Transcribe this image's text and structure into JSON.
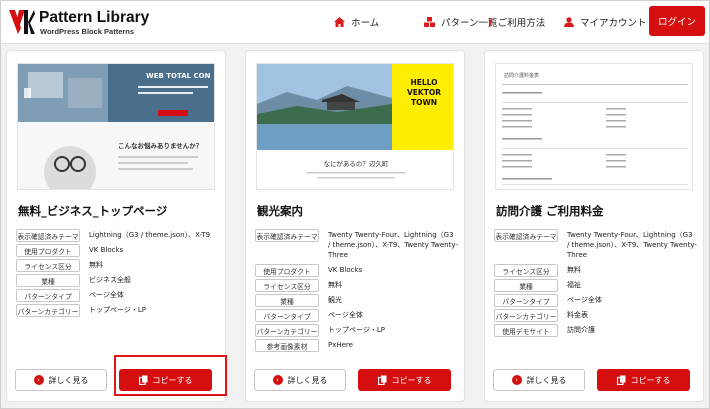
{
  "header": {
    "logo_title": "Pattern Library",
    "logo_subtitle": "WordPress Block Patterns",
    "nav": [
      {
        "label": "ホーム",
        "icon": "home-icon"
      },
      {
        "label": "パターン一覧",
        "icon": "cubes-icon"
      },
      {
        "label": "ご利用方法",
        "icon": "info-icon"
      },
      {
        "label": "マイアカウント",
        "icon": "user-icon"
      }
    ],
    "login_label": "ログイン"
  },
  "accent_color": "#d50f0f",
  "cards": [
    {
      "title": "無料_ビジネス_トップページ",
      "thumb": {
        "hero_text": "WEB TOTAL CON",
        "question": "こんなお悩みありませんか？"
      },
      "meta": [
        {
          "key": "表示確認済みテーマ",
          "value": "Lightning（G3 / theme.json）、X-T9"
        },
        {
          "key": "使用プロダクト",
          "value": "VK Blocks"
        },
        {
          "key": "ライセンス区分",
          "value": "無料"
        },
        {
          "key": "業種",
          "value": "ビジネス全般"
        },
        {
          "key": "パターンタイプ",
          "value": "ページ全体"
        },
        {
          "key": "パターンカテゴリー",
          "value": "トップページ・LP"
        }
      ],
      "detail_label": "詳しく見る",
      "copy_label": "コピーする"
    },
    {
      "title": "観光案内",
      "thumb": {
        "hello_text": "HELLO VEKTOR TOWN",
        "caption": "なにがあるの？辺久町"
      },
      "meta": [
        {
          "key": "表示確認済みテーマ",
          "value": "Twenty Twenty-Four、Lightning（G3 / theme.json）、X-T9、Twenty Twenty-Three"
        },
        {
          "key": "使用プロダクト",
          "value": "VK Blocks"
        },
        {
          "key": "ライセンス区分",
          "value": "無料"
        },
        {
          "key": "業種",
          "value": "観光"
        },
        {
          "key": "パターンタイプ",
          "value": "ページ全体"
        },
        {
          "key": "パターンカテゴリー",
          "value": "トップページ・LP"
        },
        {
          "key": "参考画像素材",
          "value": "PxHere"
        }
      ],
      "detail_label": "詳しく見る",
      "copy_label": "コピーする"
    },
    {
      "title": "訪問介護 ご利用料金",
      "thumb": {
        "heading": "訪問介護料金表"
      },
      "meta": [
        {
          "key": "表示確認済みテーマ",
          "value": "Twenty Twenty-Four、Lightning（G3 / theme.json）、X-T9、Twenty Twenty-Three"
        },
        {
          "key": "ライセンス区分",
          "value": "無料"
        },
        {
          "key": "業種",
          "value": "福祉"
        },
        {
          "key": "パターンタイプ",
          "value": "ページ全体"
        },
        {
          "key": "パターンカテゴリー",
          "value": "料金表"
        },
        {
          "key": "使用デモサイト",
          "value": "訪問介護"
        }
      ],
      "detail_label": "詳しく見る",
      "copy_label": "コピーする"
    }
  ]
}
